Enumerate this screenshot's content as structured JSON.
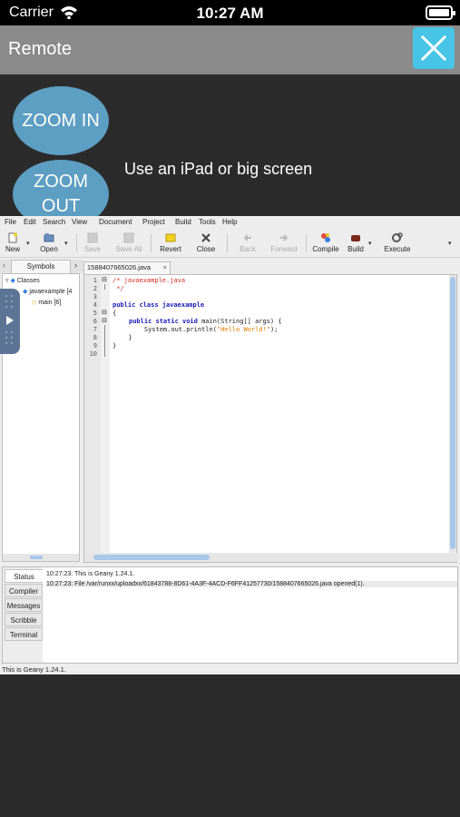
{
  "status_bar": {
    "carrier": "Carrier",
    "time": "10:27 AM"
  },
  "remote": {
    "title": "Remote"
  },
  "zoom": {
    "zoom_in": "ZOOM IN",
    "zoom_out": "ZOOM OUT",
    "hint": "Use an iPad or big screen"
  },
  "geany": {
    "menu": [
      "File",
      "Edit",
      "Search",
      "View",
      "Document",
      "Project",
      "Build",
      "Tools",
      "Help"
    ],
    "toolbar": {
      "new": "New",
      "open": "Open",
      "save": "Save",
      "save_all": "Save All",
      "revert": "Revert",
      "close": "Close",
      "back": "Back",
      "forward": "Forward",
      "compile": "Compile",
      "build": "Build",
      "execute": "Execute"
    },
    "sidebar": {
      "tab": "Symbols",
      "tree": {
        "classes": "Classes",
        "class_item": "javaexample [4",
        "method_item": "main [6]"
      }
    },
    "editor": {
      "tab_title": "1588407665026.java",
      "line_numbers": [
        "1",
        "2",
        "3",
        "4",
        "5",
        "6",
        "7",
        "8",
        "9",
        "10"
      ],
      "code": {
        "l1": "/* javaexample.java",
        "l2": " */",
        "l4": "public class javaexample",
        "l5": "{",
        "l6_kw": "public static void",
        "l6_rest": " main(String[] args) {",
        "l7_pre": "    System.out.println(",
        "l7_str": "\"Hello World!\"",
        "l7_post": ");",
        "l8": "  }",
        "l9": "}"
      }
    },
    "messages": {
      "tabs": [
        "Status",
        "Compiler",
        "Messages",
        "Scribble",
        "Terminal"
      ],
      "lines": [
        "10:27:23: This is Geany 1.24.1.",
        "10:27:23: File /var/runxx/uploadxx/61843788-8D61-4A3F-4ACD-F6FF41257730/1588407665026.java opened(1)."
      ]
    },
    "statusline": "This is Geany 1.24.1."
  }
}
